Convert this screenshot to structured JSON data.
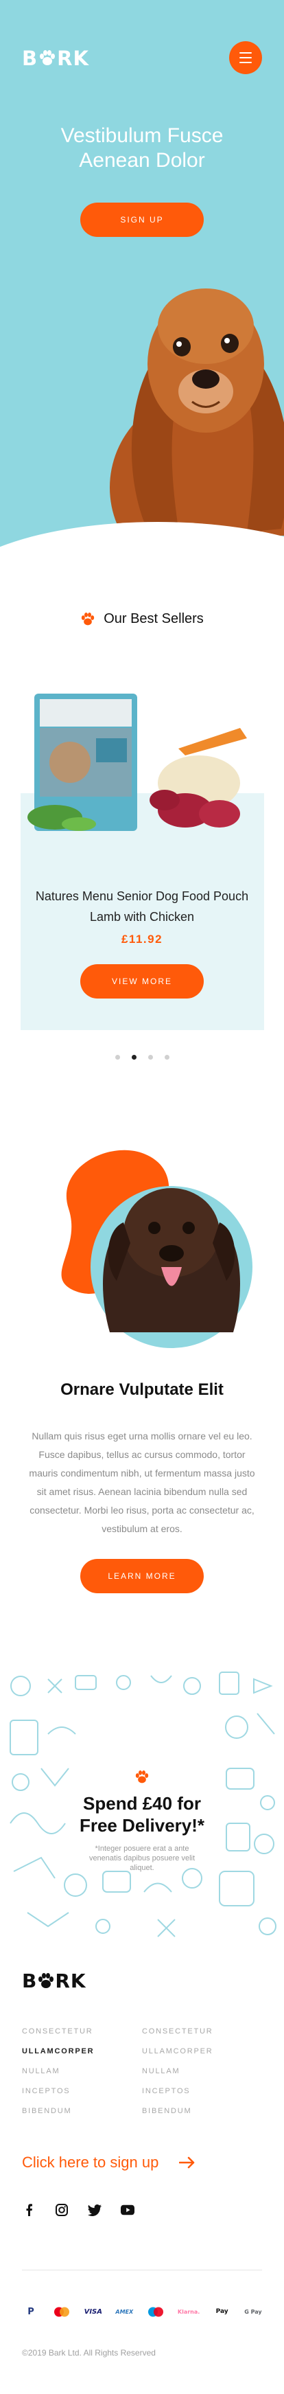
{
  "header": {
    "logo_text_1": "B",
    "logo_text_2": "RK",
    "menu_icon": "hamburger-menu-icon"
  },
  "hero": {
    "title": "Vestibulum Fusce Aenean Dolor",
    "cta_label": "SIGN UP"
  },
  "best_sellers": {
    "heading": "Our Best Sellers",
    "product": {
      "name": "Natures Menu Senior Dog Food Pouch Lamb with Chicken",
      "price": "£11.92",
      "button_label": "VIEW MORE"
    },
    "carousel": {
      "total_pages": 4,
      "active_index": 1
    }
  },
  "feature": {
    "title": "Ornare Vulputate Elit",
    "body": "Nullam quis risus eget urna mollis ornare vel eu leo. Fusce dapibus, tellus ac cursus commodo, tortor mauris condimentum nibh, ut fermentum massa justo sit amet risus. Aenean lacinia bibendum nulla sed consectetur. Morbi leo risus, porta ac consectetur ac, vestibulum at eros.",
    "button_label": "LEARN MORE"
  },
  "delivery": {
    "title": "Spend £40 for Free Delivery!*",
    "note": "*Integer posuere erat a ante venenatis dapibus posuere velit aliquet."
  },
  "footer": {
    "logo_text_1": "B",
    "logo_text_2": "RK",
    "col1": [
      "CONSECTETUR",
      "ULLAMCORPER",
      "NULLAM",
      "INCEPTOS",
      "BIBENDUM"
    ],
    "col2": [
      "CONSECTETUR",
      "ULLAMCORPER",
      "NULLAM",
      "INCEPTOS",
      "BIBENDUM"
    ],
    "signup_label": "Click here to sign up",
    "socials": [
      "facebook-icon",
      "instagram-icon",
      "twitter-icon",
      "youtube-icon"
    ],
    "payments": [
      {
        "name": "paypal-icon",
        "label": "P"
      },
      {
        "name": "mastercard-icon",
        "label": ""
      },
      {
        "name": "visa-icon",
        "label": "VISA"
      },
      {
        "name": "amex-icon",
        "label": "AMEX"
      },
      {
        "name": "maestro-icon",
        "label": ""
      },
      {
        "name": "klarna-icon",
        "label": "Klarna."
      },
      {
        "name": "apple-pay-icon",
        "label": "Pay"
      },
      {
        "name": "google-pay-icon",
        "label": "G Pay"
      }
    ],
    "copyright": "©2019 Bark Ltd. All Rights Reserved"
  },
  "colors": {
    "accent": "#ff5a0a",
    "hero_bg": "#8fd7e0",
    "panel_bg": "#e6f5f7",
    "doodle": "#9fd8e2"
  }
}
